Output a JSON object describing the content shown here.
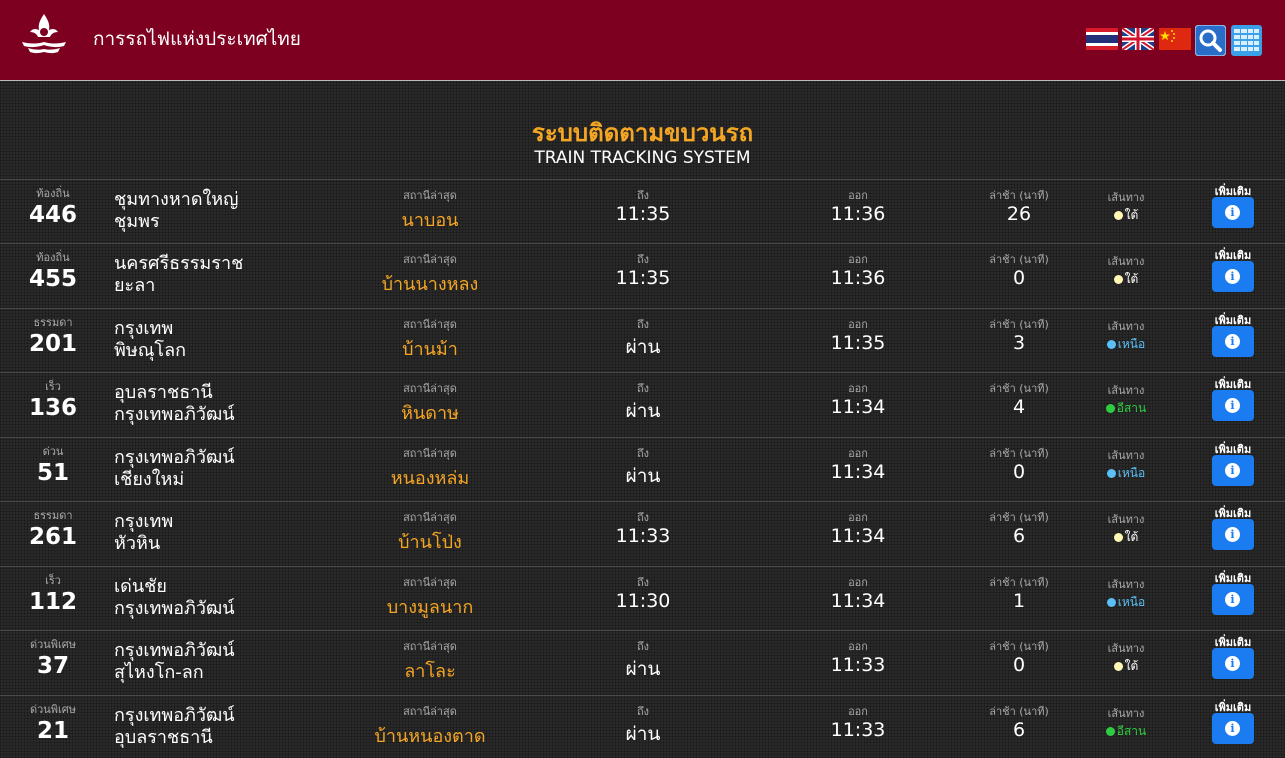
{
  "header": {
    "site_title": "การรถไฟแห่งประเทศไทย",
    "icons": [
      "thai-flag-icon",
      "uk-flag-icon",
      "china-flag-icon",
      "search-icon",
      "table-grid-icon"
    ]
  },
  "page": {
    "title_th": "ระบบติดตามขบวนรถ",
    "title_en": "TRAIN TRACKING SYSTEM"
  },
  "labels": {
    "station": "สถานีล่าสุด",
    "arrive": "ถึง",
    "depart": "ออก",
    "delay": "ล่าช้า (นาที)",
    "line": "เส้นทาง",
    "more": "เพิ่มเติม"
  },
  "colors": {
    "header_bg": "#7d0020",
    "station_text": "#f5a623",
    "info_button": "#1a7cf0",
    "line_south": "#fff7b3",
    "line_north": "#5bc0f8",
    "line_northeast": "#2ecc40"
  },
  "trains": [
    {
      "type": "ท้องถิ่น",
      "number": "446",
      "from": "ชุมทางหาดใหญ่",
      "to": "ชุมพร",
      "station": "นาบอน",
      "arrive": "11:35",
      "depart": "11:36",
      "delay": "26",
      "line": "ใต้",
      "line_color": "#fff7b3"
    },
    {
      "type": "ท้องถิ่น",
      "number": "455",
      "from": "นครศรีธรรมราช",
      "to": "ยะลา",
      "station": "บ้านนางหลง",
      "arrive": "11:35",
      "depart": "11:36",
      "delay": "0",
      "line": "ใต้",
      "line_color": "#fff7b3"
    },
    {
      "type": "ธรรมดา",
      "number": "201",
      "from": "กรุงเทพ",
      "to": "พิษณุโลก",
      "station": "บ้านม้า",
      "arrive": "ผ่าน",
      "depart": "11:35",
      "delay": "3",
      "line": "เหนือ",
      "line_color": "#5bc0f8"
    },
    {
      "type": "เร็ว",
      "number": "136",
      "from": "อุบลราชธานี",
      "to": "กรุงเทพอภิวัฒน์",
      "station": "หินดาษ",
      "arrive": "ผ่าน",
      "depart": "11:34",
      "delay": "4",
      "line": "อีสาน",
      "line_color": "#2ecc40"
    },
    {
      "type": "ด่วน",
      "number": "51",
      "from": "กรุงเทพอภิวัฒน์",
      "to": "เชียงใหม่",
      "station": "หนองหล่ม",
      "arrive": "ผ่าน",
      "depart": "11:34",
      "delay": "0",
      "line": "เหนือ",
      "line_color": "#5bc0f8"
    },
    {
      "type": "ธรรมดา",
      "number": "261",
      "from": "กรุงเทพ",
      "to": "หัวหิน",
      "station": "บ้านโป่ง",
      "arrive": "11:33",
      "depart": "11:34",
      "delay": "6",
      "line": "ใต้",
      "line_color": "#fff7b3"
    },
    {
      "type": "เร็ว",
      "number": "112",
      "from": "เด่นชัย",
      "to": "กรุงเทพอภิวัฒน์",
      "station": "บางมูลนาก",
      "arrive": "11:30",
      "depart": "11:34",
      "delay": "1",
      "line": "เหนือ",
      "line_color": "#5bc0f8"
    },
    {
      "type": "ด่วนพิเศษ",
      "number": "37",
      "from": "กรุงเทพอภิวัฒน์",
      "to": "สุไหงโก-ลก",
      "station": "ลาโละ",
      "arrive": "ผ่าน",
      "depart": "11:33",
      "delay": "0",
      "line": "ใต้",
      "line_color": "#fff7b3"
    },
    {
      "type": "ด่วนพิเศษ",
      "number": "21",
      "from": "กรุงเทพอภิวัฒน์",
      "to": "อุบลราชธานี",
      "station": "บ้านหนองตาด",
      "arrive": "ผ่าน",
      "depart": "11:33",
      "delay": "6",
      "line": "อีสาน",
      "line_color": "#2ecc40"
    }
  ]
}
